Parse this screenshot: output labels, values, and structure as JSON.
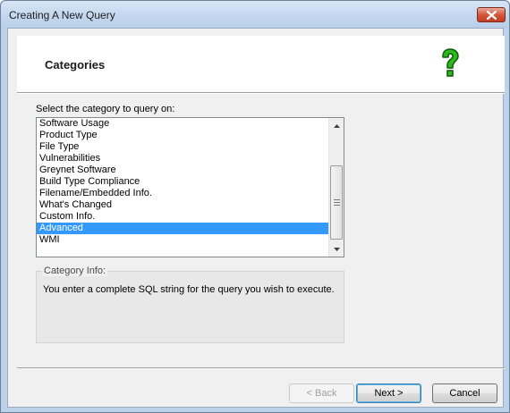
{
  "window": {
    "title": "Creating A New Query"
  },
  "header": {
    "title": "Categories",
    "icon": "help-question-icon",
    "icon_color": "#22a016"
  },
  "category_list": {
    "label": "Select the category to query on:",
    "items": [
      "Software Usage",
      "Product Type",
      "File Type",
      "Vulnerabilities",
      "Greynet Software",
      "Build Type Compliance",
      "Filename/Embedded Info.",
      "What's Changed",
      "Custom Info.",
      "Advanced",
      "WMI"
    ],
    "selected": "Advanced",
    "selection_color": "#3399ff"
  },
  "category_info": {
    "legend": "Category Info:",
    "text": "You enter a complete SQL string for the query you wish to execute."
  },
  "buttons": {
    "back": "< Back",
    "next": "Next >",
    "cancel": "Cancel"
  }
}
